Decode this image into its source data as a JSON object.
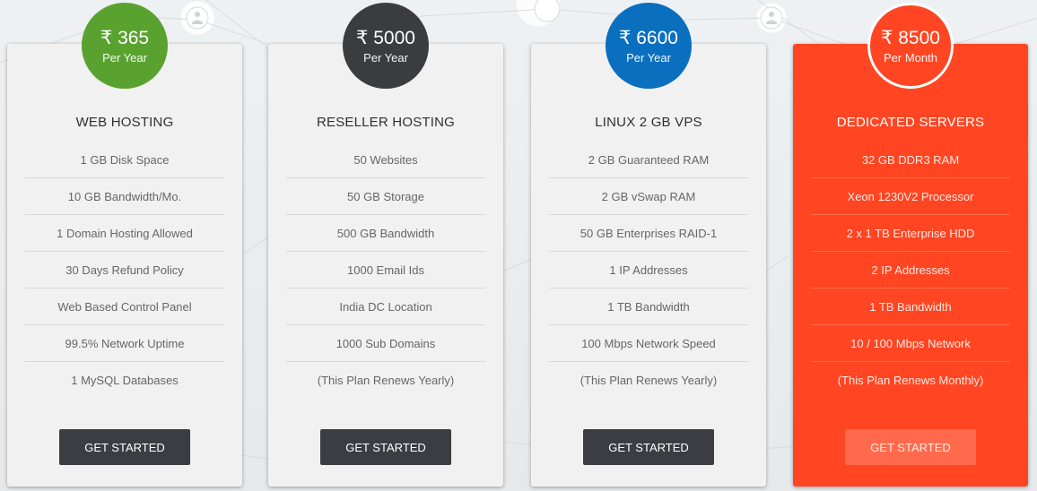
{
  "plans": [
    {
      "price": "₹ 365",
      "period": "Per Year",
      "title": "WEB HOSTING",
      "features": [
        "1 GB Disk Space",
        "10 GB Bandwidth/Mo.",
        "1 Domain Hosting Allowed",
        "30 Days Refund Policy",
        "Web Based Control Panel",
        "99.5% Network Uptime",
        "1 MySQL Databases"
      ],
      "cta": "GET STARTED",
      "color": "#5aa22f"
    },
    {
      "price": "₹ 5000",
      "period": "Per Year",
      "title": "RESELLER HOSTING",
      "features": [
        "50 Websites",
        "50 GB Storage",
        "500 GB Bandwidth",
        "1000 Email Ids",
        "India DC Location",
        "1000 Sub Domains",
        "(This Plan Renews Yearly)"
      ],
      "cta": "GET STARTED",
      "color": "#3b3c3f"
    },
    {
      "price": "₹ 6600",
      "period": "Per Year",
      "title": "LINUX 2 GB VPS",
      "features": [
        "2 GB Guaranteed RAM",
        "2 GB vSwap RAM",
        "50 GB Enterprises RAID-1",
        "1 IP Addresses",
        "1 TB Bandwidth",
        "100 Mbps Network Speed",
        "(This Plan Renews Yearly)"
      ],
      "cta": "GET STARTED",
      "color": "#0a6fbf"
    },
    {
      "price": "₹ 8500",
      "period": "Per Month",
      "title": "DEDICATED SERVERS",
      "features": [
        "32 GB DDR3 RAM",
        "Xeon 1230V2 Processor",
        "2 x 1 TB Enterprise HDD",
        "2 IP Addresses",
        "1 TB Bandwidth",
        "10 / 100 Mbps Network",
        "(This Plan Renews Monthly)"
      ],
      "cta": "GET STARTED",
      "color": "#ff4522"
    }
  ]
}
